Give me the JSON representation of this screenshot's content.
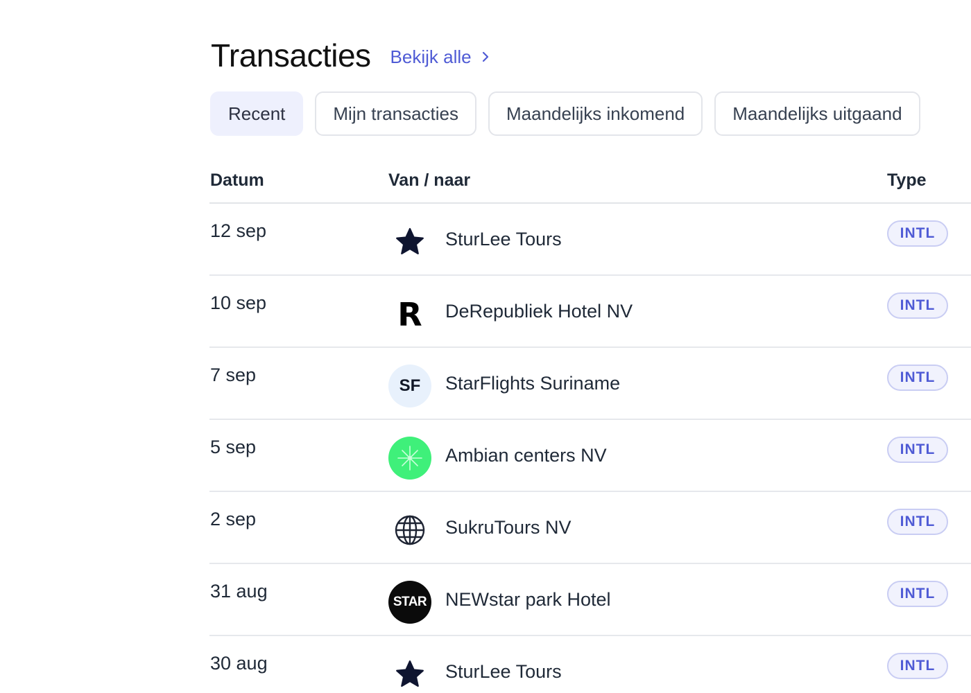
{
  "header": {
    "title": "Transacties",
    "view_all": "Bekijk alle"
  },
  "tabs": [
    {
      "label": "Recent",
      "active": true
    },
    {
      "label": "Mijn transacties",
      "active": false
    },
    {
      "label": "Maandelijks inkomend",
      "active": false
    },
    {
      "label": "Maandelijks uitgaand",
      "active": false
    }
  ],
  "table": {
    "columns": {
      "date": "Datum",
      "party": "Van / naar",
      "type": "Type"
    },
    "rows": [
      {
        "date": "12 sep",
        "name": "SturLee Tours",
        "logo": "star-icon",
        "type": "INTL"
      },
      {
        "date": "10 sep",
        "name": "DeRepubliek Hotel NV",
        "logo": "r-logo-icon",
        "logo_text": "R",
        "type": "INTL"
      },
      {
        "date": "7 sep",
        "name": "StarFlights Suriname",
        "logo": "sf-initials-avatar",
        "logo_text": "SF",
        "type": "INTL"
      },
      {
        "date": "5 sep",
        "name": "Ambian centers NV",
        "logo": "green-sparkle-icon",
        "type": "INTL"
      },
      {
        "date": "2 sep",
        "name": "SukruTours NV",
        "logo": "globe-icon",
        "type": "INTL"
      },
      {
        "date": "31 aug",
        "name": "NEWstar park Hotel",
        "logo": "star-text-logo",
        "logo_text": "STAR",
        "type": "INTL"
      },
      {
        "date": "30 aug",
        "name": "SturLee Tours",
        "logo": "star-icon",
        "type": "INTL"
      }
    ]
  },
  "colors": {
    "accent": "#4f5bd5",
    "active_tab_bg": "#eef0fd",
    "badge_bg": "#f1f2fd",
    "badge_border": "#c9cdf3",
    "green_logo": "#3ff07a",
    "star_icon": "#0f1530"
  }
}
